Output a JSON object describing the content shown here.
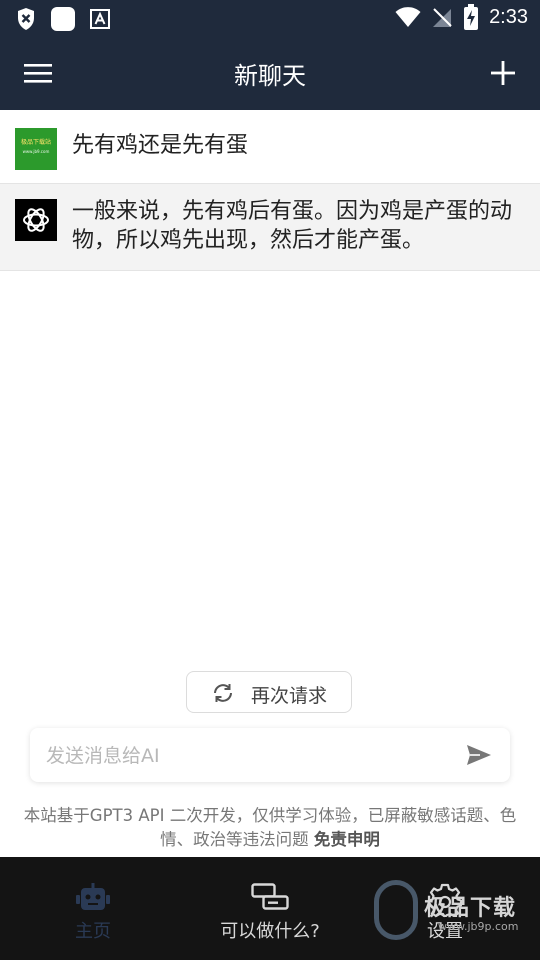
{
  "status_bar": {
    "time": "2:33"
  },
  "app_bar": {
    "title": "新聊天"
  },
  "messages": [
    {
      "role": "user",
      "avatar_label": "极品下载站",
      "avatar_sub": "www.jb9.com",
      "text": "先有鸡还是先有蛋"
    },
    {
      "role": "ai",
      "text": "一般来说，先有鸡后有蛋。因为鸡是产蛋的动物，所以鸡先出现，然后才能产蛋。"
    }
  ],
  "retry_button": {
    "label": "再次请求"
  },
  "input": {
    "placeholder": "发送消息给AI",
    "value": ""
  },
  "disclaimer": {
    "text": "本站基于GPT3 API 二次开发，仅供学习体验，已屏蔽敏感话题、色情、政治等违法问题 ",
    "link": "免责申明"
  },
  "bottom_nav": {
    "items": [
      {
        "label": "主页",
        "icon": "robot-icon"
      },
      {
        "label": "可以做什么?",
        "icon": "card-icon"
      },
      {
        "label": "设置",
        "icon": "gear-icon"
      }
    ]
  },
  "watermark": {
    "text": "极品下载",
    "url": "www.jb9p.com"
  },
  "colors": {
    "header_bg": "#1f2a3c",
    "nav_bg": "#141414",
    "ai_bg": "#f3f3f3",
    "user_avatar": "#2c9a2c"
  }
}
